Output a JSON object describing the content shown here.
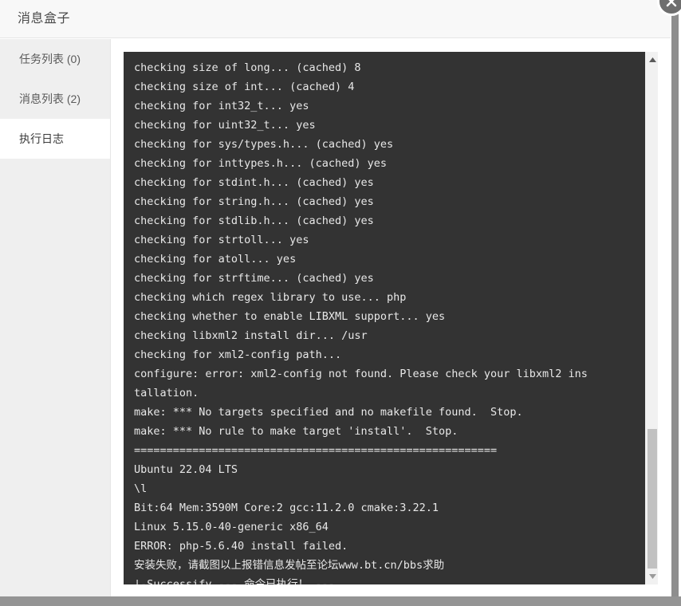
{
  "header": {
    "title": "消息盒子",
    "close_icon": "close-x-icon"
  },
  "sidebar": {
    "items": [
      {
        "label": "任务列表 (0)",
        "active": false
      },
      {
        "label": "消息列表 (2)",
        "active": false
      },
      {
        "label": "执行日志",
        "active": true
      }
    ]
  },
  "terminal": {
    "background": "#333333",
    "text_color": "#e8e8e8",
    "lines": [
      "checking size of long... (cached) 8",
      "checking size of int... (cached) 4",
      "checking for int32_t... yes",
      "checking for uint32_t... yes",
      "checking for sys/types.h... (cached) yes",
      "checking for inttypes.h... (cached) yes",
      "checking for stdint.h... (cached) yes",
      "checking for string.h... (cached) yes",
      "checking for stdlib.h... (cached) yes",
      "checking for strtoll... yes",
      "checking for atoll... yes",
      "checking for strftime... (cached) yes",
      "checking which regex library to use... php",
      "checking whether to enable LIBXML support... yes",
      "checking libxml2 install dir... /usr",
      "checking for xml2-config path...",
      "configure: error: xml2-config not found. Please check your libxml2 ins",
      "tallation.",
      "make: *** No targets specified and no makefile found.  Stop.",
      "make: *** No rule to make target 'install'.  Stop.",
      "========================================================",
      "Ubuntu 22.04 LTS",
      "\\l",
      "Bit:64 Mem:3590M Core:2 gcc:11.2.0 cmake:3.22.1",
      "Linux 5.15.0-40-generic x86_64",
      "ERROR: php-5.6.40 install failed.",
      "安装失败，请截图以上报错信息发帖至论坛www.bt.cn/bbs求助",
      "|-Successify --- 命令已执行！ ---"
    ]
  },
  "scrollbar": {
    "up_arrow_icon": "chevron-up-icon",
    "down_arrow_icon": "chevron-down-icon",
    "thumb_color": "#c1c1c1",
    "track_color": "#f1f1f1"
  },
  "page_scrollbar": {
    "thumb_color": "#8e8e8e"
  }
}
